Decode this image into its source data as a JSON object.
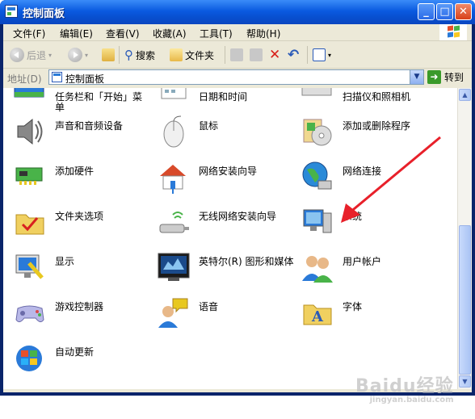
{
  "window": {
    "title": "控制面板",
    "min_glyph": "_",
    "max_glyph": "□",
    "close_glyph": "✕"
  },
  "menu": [
    "文件(F)",
    "编辑(E)",
    "查看(V)",
    "收藏(A)",
    "工具(T)",
    "帮助(H)"
  ],
  "toolbar": {
    "back_label": "后退",
    "search_label": "搜索",
    "folders_label": "文件夹"
  },
  "address": {
    "label": "地址(D)",
    "value": "控制面板",
    "go_label": "转到"
  },
  "items": [
    {
      "label": "任务栏和「开始」菜单",
      "icon": "taskbar-icon"
    },
    {
      "label": "日期和时间",
      "icon": "calendar-icon"
    },
    {
      "label": "扫描仪和照相机",
      "icon": "scanner-icon"
    },
    {
      "label": "声音和音频设备",
      "icon": "speaker-icon"
    },
    {
      "label": "鼠标",
      "icon": "mouse-icon"
    },
    {
      "label": "添加或删除程序",
      "icon": "add-remove-programs-icon"
    },
    {
      "label": "添加硬件",
      "icon": "hardware-icon"
    },
    {
      "label": "网络安装向导",
      "icon": "network-house-icon"
    },
    {
      "label": "网络连接",
      "icon": "network-globe-icon"
    },
    {
      "label": "文件夹选项",
      "icon": "folder-options-icon"
    },
    {
      "label": "无线网络安装向导",
      "icon": "wireless-icon"
    },
    {
      "label": "系统",
      "icon": "system-computer-icon"
    },
    {
      "label": "显示",
      "icon": "display-icon"
    },
    {
      "label": "英特尔(R) 图形和媒体",
      "icon": "intel-graphics-icon"
    },
    {
      "label": "用户帐户",
      "icon": "user-accounts-icon"
    },
    {
      "label": "游戏控制器",
      "icon": "gamepad-icon"
    },
    {
      "label": "语音",
      "icon": "speech-icon"
    },
    {
      "label": "字体",
      "icon": "fonts-folder-icon"
    },
    {
      "label": "自动更新",
      "icon": "windows-update-icon"
    }
  ],
  "colors": {
    "title_bar": "#0a5ae0",
    "annotation_arrow": "#e8202a"
  },
  "watermark": {
    "text": "Baidu经验",
    "sub": "jingyan.baidu.com"
  }
}
